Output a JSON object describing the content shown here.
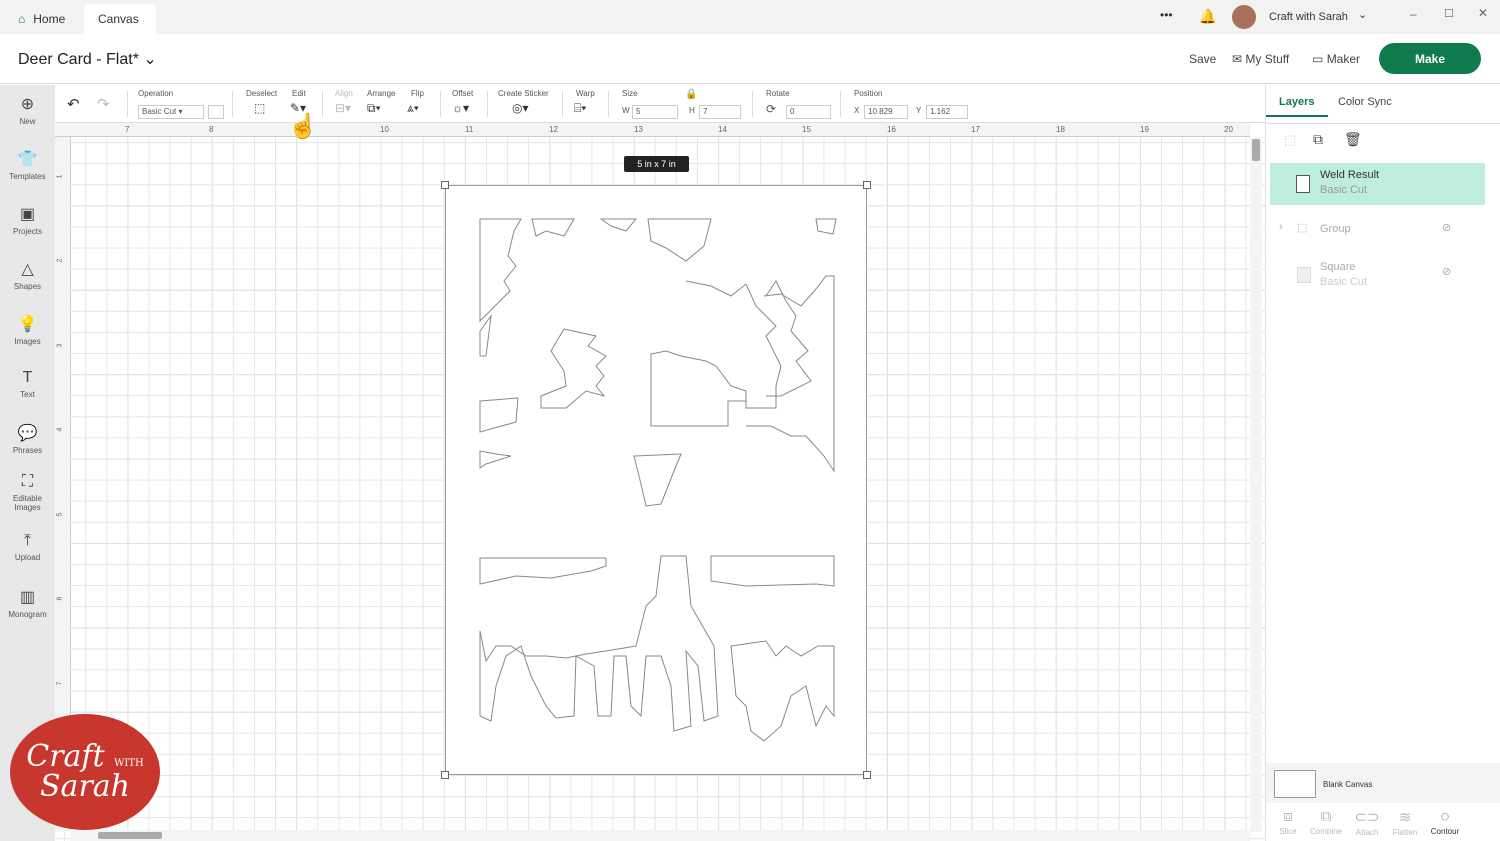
{
  "tabs": [
    {
      "label": "Home"
    },
    {
      "label": "Canvas"
    }
  ],
  "window": {
    "account": "Craft with Sarah",
    "menu": "•••"
  },
  "header": {
    "title": "Deer Card - Flat*",
    "save": "Save",
    "my_stuff": "My Stuff",
    "maker": "Maker",
    "make": "Make"
  },
  "sidebar": [
    {
      "label": "New",
      "icon": "⊕"
    },
    {
      "label": "Templates",
      "icon": "👕"
    },
    {
      "label": "Projects",
      "icon": "▣"
    },
    {
      "label": "Shapes",
      "icon": "△"
    },
    {
      "label": "Images",
      "icon": "💡"
    },
    {
      "label": "Text",
      "icon": "T"
    },
    {
      "label": "Phrases",
      "icon": "💬"
    },
    {
      "label": "Editable Images",
      "icon": "⛶"
    },
    {
      "label": "Upload",
      "icon": "⤒"
    },
    {
      "label": "Monogram",
      "icon": "▥"
    }
  ],
  "toolbar": {
    "operation_label": "Operation",
    "operation_value": "Basic Cut",
    "deselect": "Deselect",
    "edit": "Edit",
    "align": "Align",
    "arrange": "Arrange",
    "flip": "Flip",
    "offset": "Offset",
    "create_sticker": "Create Sticker",
    "warp": "Warp",
    "size": "Size",
    "w_label": "W",
    "w": "5",
    "h_label": "H",
    "h": "7",
    "rotate": "Rotate",
    "rotate_value": "0",
    "position": "Position",
    "x_label": "X",
    "x": "10.829",
    "y_label": "Y",
    "y": "1.162"
  },
  "ruler_top": [
    "7",
    "8",
    "10",
    "11",
    "12",
    "13",
    "14",
    "15",
    "16",
    "17",
    "18",
    "19",
    "20"
  ],
  "ruler_left": [
    "1",
    "2",
    "3",
    "4",
    "5",
    "6",
    "7"
  ],
  "size_tag": "5 in x 7 in",
  "panel": {
    "tabs": [
      "Layers",
      "Color Sync"
    ],
    "layers": [
      {
        "name": "Weld Result",
        "sub": "Basic Cut"
      },
      {
        "name": "Group",
        "sub": ""
      },
      {
        "name": "Square",
        "sub": "Basic Cut"
      }
    ],
    "blank_canvas": "Blank Canvas",
    "bottom": [
      "Slice",
      "Combine",
      "Attach",
      "Flatten",
      "Contour"
    ]
  },
  "watermark": {
    "line1": "Craft",
    "line2": "with",
    "line3": "Sarah"
  },
  "colors": {
    "accent": "#0f7a4b",
    "selected_layer": "#bdeedd"
  }
}
